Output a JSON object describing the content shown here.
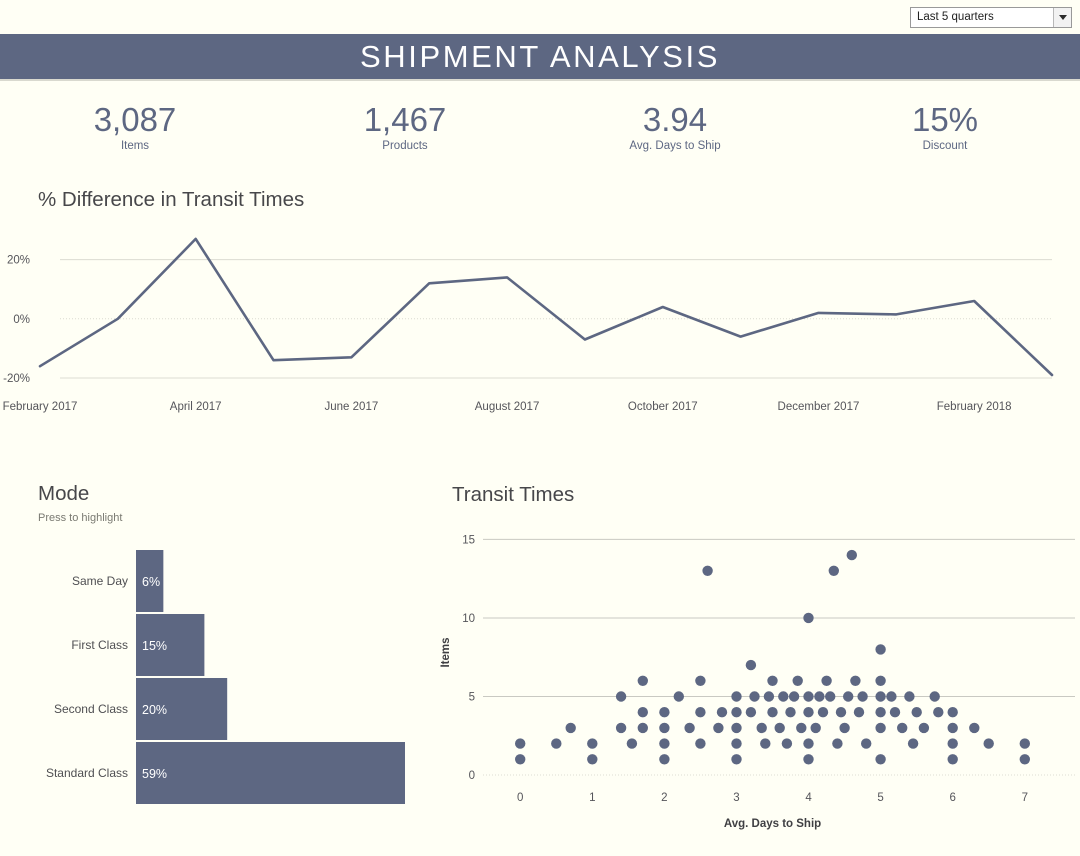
{
  "filter": {
    "name": "date-range-filter",
    "value": "Last 5 quarters",
    "arrow_icon": "chevron-down-icon"
  },
  "header": {
    "title": "SHIPMENT ANALYSIS",
    "background": "#5d6782"
  },
  "kpis": [
    {
      "value": "3,087",
      "label": "Items"
    },
    {
      "value": "1,467",
      "label": "Products"
    },
    {
      "value": "3.94",
      "label": "Avg. Days to Ship"
    },
    {
      "value": "15%",
      "label": "Discount"
    }
  ],
  "theme": {
    "accent": "#5d6782",
    "background": "#fffff5",
    "text": "#47474a",
    "grid": "#dcdcd2"
  },
  "chart_data": [
    {
      "id": "transit-difference-line",
      "type": "line",
      "title": "% Difference in Transit Times",
      "xlabel": "",
      "ylabel": "",
      "ylim": [
        -20,
        30
      ],
      "yticks": [
        "-20%",
        "0%",
        "20%"
      ],
      "ytick_values": [
        -20,
        0,
        20
      ],
      "grid": true,
      "legend": "none",
      "xtick_labels": [
        "February 2017",
        "April 2017",
        "June 2017",
        "August 2017",
        "October 2017",
        "December 2017",
        "February 2018"
      ],
      "x": [
        "February 2017",
        "March 2017",
        "April 2017",
        "May 2017",
        "June 2017",
        "July 2017",
        "August 2017",
        "September 2017",
        "October 2017",
        "November 2017",
        "December 2017",
        "January 2018",
        "February 2018",
        "March 2018"
      ],
      "values": [
        -16,
        0,
        27,
        -14,
        -13,
        12,
        14,
        -7,
        4,
        -6,
        2,
        1.5,
        6,
        -19
      ],
      "line_color": "#5d6782"
    },
    {
      "id": "mode-bar",
      "type": "bar",
      "title": "Mode",
      "subtitle": "Press to highlight",
      "orientation": "horizontal",
      "categories": [
        "Same Day",
        "First Class",
        "Second Class",
        "Standard Class"
      ],
      "values": [
        6,
        15,
        20,
        59
      ],
      "value_labels": [
        "6%",
        "15%",
        "20%",
        "59%"
      ],
      "xlim": [
        0,
        59
      ],
      "grid": false,
      "bar_color": "#5d6782"
    },
    {
      "id": "transit-times-scatter",
      "type": "scatter",
      "title": "Transit Times",
      "xlabel": "Avg. Days to Ship",
      "ylabel": "Items",
      "xlim": [
        -0.35,
        7.35
      ],
      "ylim": [
        0,
        15.6
      ],
      "xticks": [
        0,
        1,
        2,
        3,
        4,
        5,
        6,
        7
      ],
      "yticks": [
        0,
        5,
        10,
        15
      ],
      "grid": true,
      "point_color": "#5d6782",
      "points": [
        [
          0,
          2
        ],
        [
          0,
          1
        ],
        [
          0.5,
          2
        ],
        [
          0.7,
          3
        ],
        [
          1,
          2
        ],
        [
          1,
          1
        ],
        [
          1.4,
          3
        ],
        [
          1.4,
          5
        ],
        [
          1.55,
          2
        ],
        [
          1.7,
          3
        ],
        [
          1.7,
          4
        ],
        [
          1.7,
          6
        ],
        [
          2,
          1
        ],
        [
          2,
          2
        ],
        [
          2,
          3
        ],
        [
          2,
          4
        ],
        [
          2.2,
          5
        ],
        [
          2.35,
          3
        ],
        [
          2.5,
          2
        ],
        [
          2.5,
          4
        ],
        [
          2.5,
          6
        ],
        [
          2.6,
          13
        ],
        [
          2.75,
          3
        ],
        [
          2.8,
          4
        ],
        [
          3,
          1
        ],
        [
          3,
          2
        ],
        [
          3,
          3
        ],
        [
          3,
          4
        ],
        [
          3,
          5
        ],
        [
          3.2,
          4
        ],
        [
          3.2,
          7
        ],
        [
          3.25,
          5
        ],
        [
          3.35,
          3
        ],
        [
          3.4,
          2
        ],
        [
          3.45,
          5
        ],
        [
          3.5,
          4
        ],
        [
          3.5,
          6
        ],
        [
          3.6,
          3
        ],
        [
          3.65,
          5
        ],
        [
          3.7,
          2
        ],
        [
          3.75,
          4
        ],
        [
          3.8,
          5
        ],
        [
          3.85,
          6
        ],
        [
          3.9,
          3
        ],
        [
          4,
          1
        ],
        [
          4,
          2
        ],
        [
          4,
          4
        ],
        [
          4,
          5
        ],
        [
          4,
          10
        ],
        [
          4.1,
          3
        ],
        [
          4.15,
          5
        ],
        [
          4.2,
          4
        ],
        [
          4.25,
          6
        ],
        [
          4.3,
          5
        ],
        [
          4.35,
          13
        ],
        [
          4.4,
          2
        ],
        [
          4.45,
          4
        ],
        [
          4.5,
          3
        ],
        [
          4.55,
          5
        ],
        [
          4.6,
          14
        ],
        [
          4.65,
          6
        ],
        [
          4.7,
          4
        ],
        [
          4.75,
          5
        ],
        [
          4.8,
          2
        ],
        [
          5,
          1
        ],
        [
          5,
          3
        ],
        [
          5,
          4
        ],
        [
          5,
          5
        ],
        [
          5,
          6
        ],
        [
          5,
          8
        ],
        [
          5.15,
          5
        ],
        [
          5.2,
          4
        ],
        [
          5.3,
          3
        ],
        [
          5.4,
          5
        ],
        [
          5.45,
          2
        ],
        [
          5.5,
          4
        ],
        [
          5.6,
          3
        ],
        [
          5.75,
          5
        ],
        [
          5.8,
          4
        ],
        [
          6,
          1
        ],
        [
          6,
          2
        ],
        [
          6,
          3
        ],
        [
          6,
          4
        ],
        [
          6.3,
          3
        ],
        [
          6.5,
          2
        ],
        [
          7,
          1
        ],
        [
          7,
          2
        ]
      ]
    }
  ]
}
